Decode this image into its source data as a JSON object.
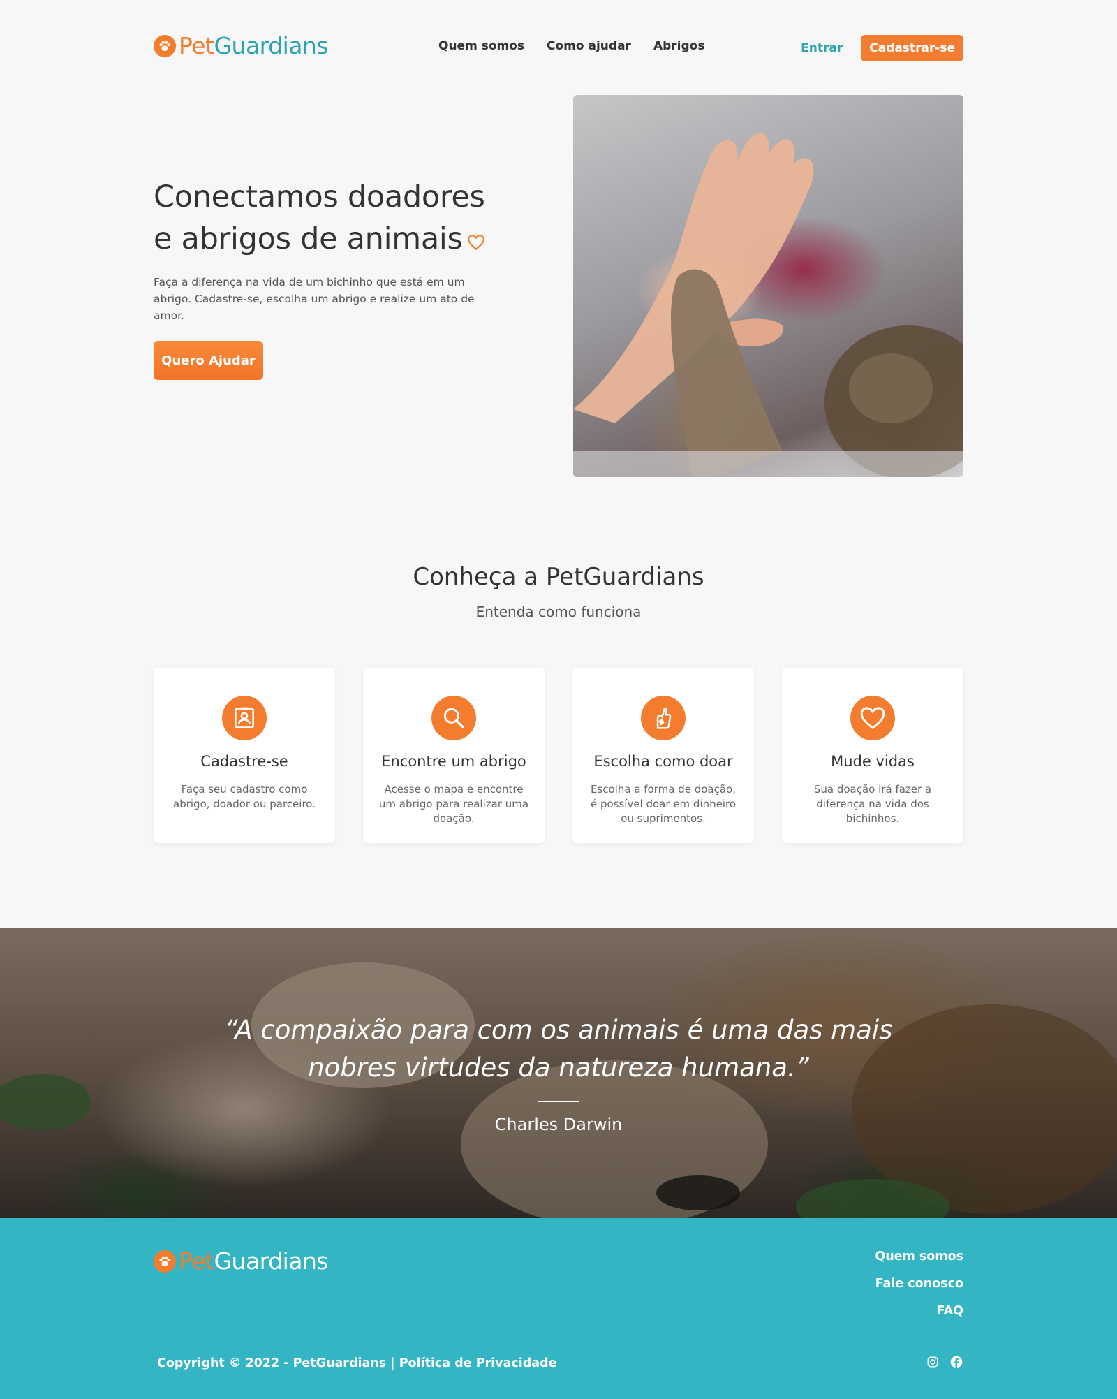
{
  "brand": {
    "part1": "Pet",
    "part2": "Guardians",
    "primary_color": "#f47c2e",
    "secondary_color": "#2ba3b3"
  },
  "nav": {
    "items": [
      {
        "label": "Quem somos"
      },
      {
        "label": "Como ajudar"
      },
      {
        "label": "Abrigos"
      }
    ],
    "login_label": "Entrar",
    "signup_label": "Cadastrar-se"
  },
  "hero": {
    "title_line1": "Conectamos doadores",
    "title_line2": "e abrigos de animais",
    "description": "Faça a diferença na vida de um bichinho que está em um abrigo. Cadastre-se, escolha um abrigo e realize um ato de amor.",
    "cta_label": "Quero Ajudar",
    "image_icon": "hand-and-cat-paw-photo"
  },
  "how": {
    "title": "Conheça a PetGuardians",
    "subtitle": "Entenda como funciona",
    "cards": [
      {
        "icon": "id-badge-icon",
        "title": "Cadastre-se",
        "desc": "Faça seu cadastro como abrigo, doador ou parceiro."
      },
      {
        "icon": "search-icon",
        "title": "Encontre um abrigo",
        "desc": "Acesse o mapa e encontre um abrigo para realizar uma doação."
      },
      {
        "icon": "hand-heart-icon",
        "title": "Escolha como doar",
        "desc": "Escolha a forma de doação, é possível doar em dinheiro ou suprimentos."
      },
      {
        "icon": "heart-icon",
        "title": "Mude vidas",
        "desc": "Sua doação irá fazer a diferença na vida dos bichinhos."
      }
    ]
  },
  "quote": {
    "text": "“A compaixão para com os animais é uma das mais nobres virtudes da natureza humana.”",
    "author": "Charles Darwin"
  },
  "footer": {
    "links": [
      {
        "label": "Quem somos"
      },
      {
        "label": "Fale conosco"
      },
      {
        "label": "FAQ"
      }
    ],
    "copyright": "Copyright © 2022 - PetGuardians | Política de Privacidade",
    "social": [
      "instagram-icon",
      "facebook-icon"
    ],
    "background_color": "#34b5c3"
  }
}
